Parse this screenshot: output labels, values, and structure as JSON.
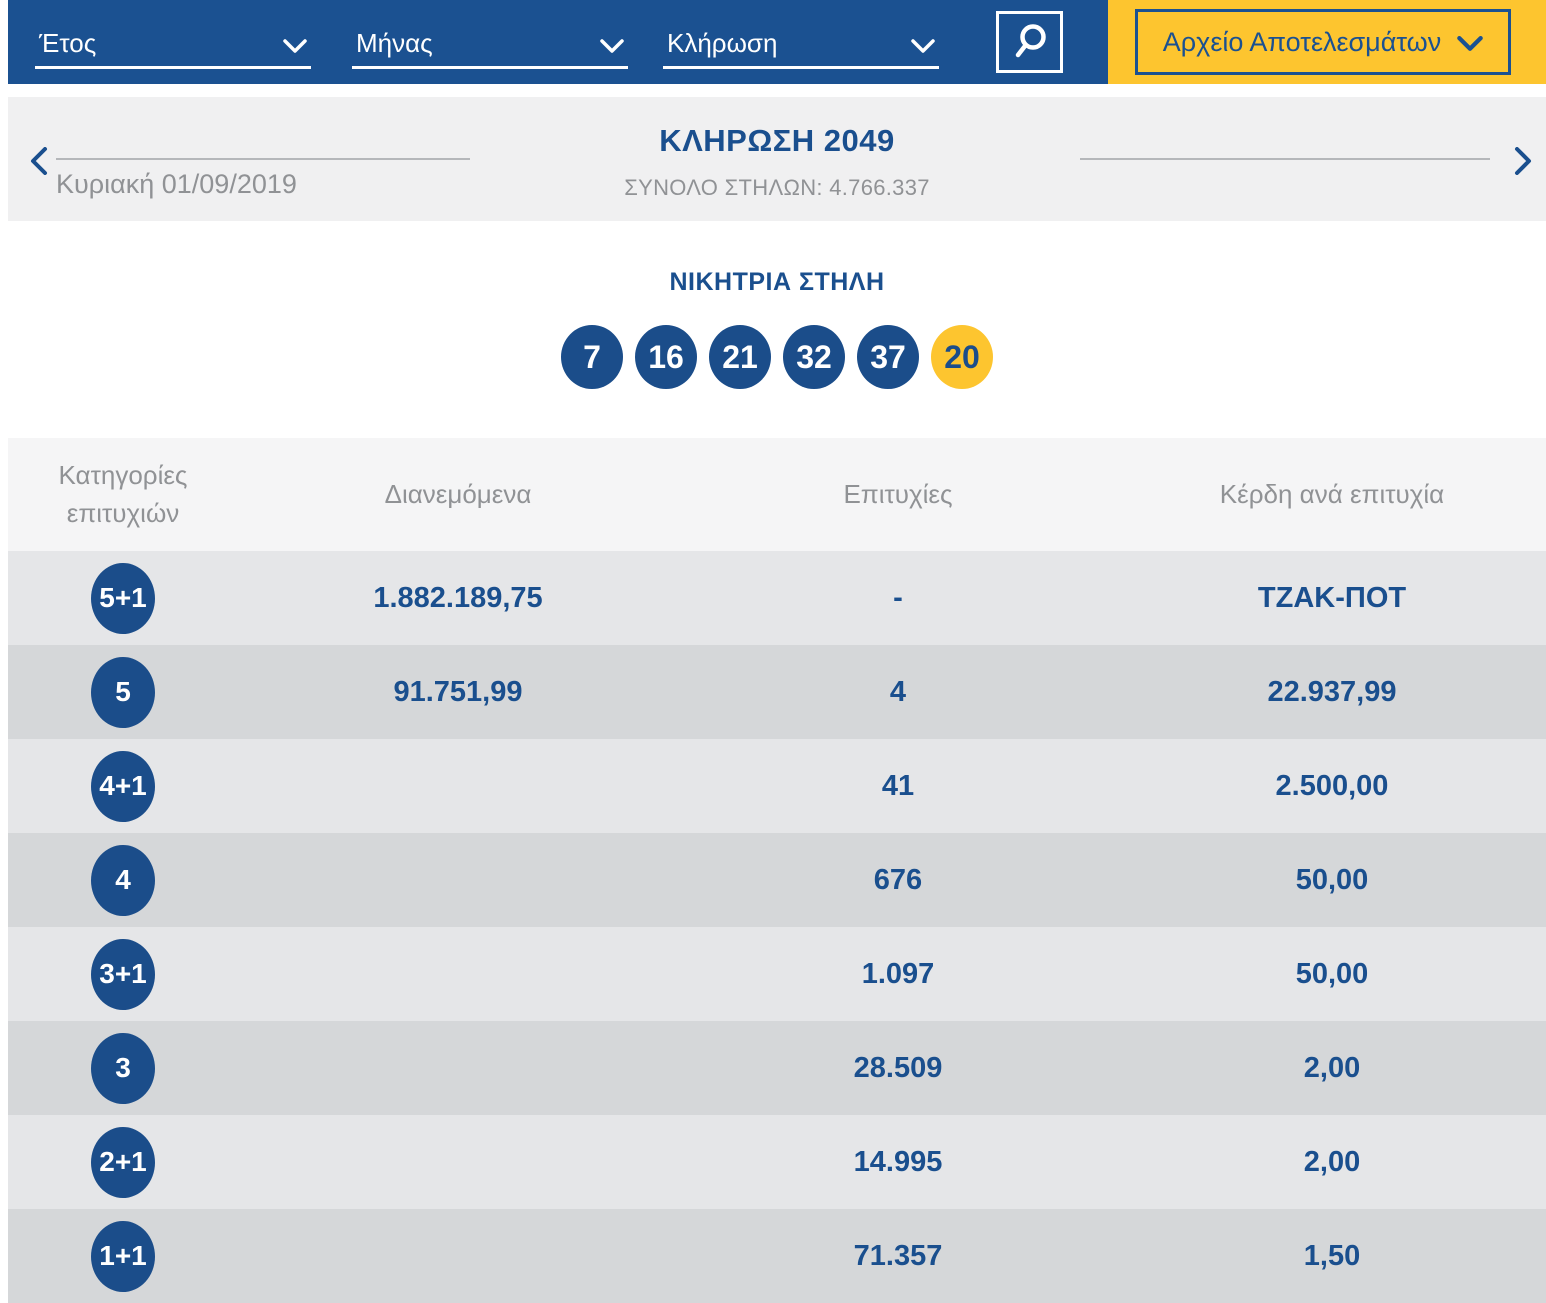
{
  "colors": {
    "bar_blue": "#1b5191",
    "accent_yellow": "#fdc52f",
    "ball_blue": "#1b4d8a",
    "text_blue": "#1a4f8e",
    "muted_gray": "#909295",
    "row_light": "#e5e6e8",
    "row_dark": "#d5d7d9"
  },
  "topbar": {
    "dropdowns": [
      {
        "label": "Έτος"
      },
      {
        "label": "Μήνας"
      },
      {
        "label": "Κλήρωση"
      }
    ],
    "search_icon": "magnifier-icon",
    "archive_button_label": "Αρχείο Αποτελεσμάτων"
  },
  "draw_nav": {
    "date": "Κυριακή 01/09/2019",
    "title": "ΚΛΗΡΩΣΗ 2049",
    "total_columns": "ΣΥΝΟΛΟ ΣΤΗΛΩΝ: 4.766.337"
  },
  "winning_column": {
    "title": "ΝΙΚΗΤΡΙΑ ΣΤΗΛΗ",
    "numbers": [
      {
        "value": "7",
        "type": "main"
      },
      {
        "value": "16",
        "type": "main"
      },
      {
        "value": "21",
        "type": "main"
      },
      {
        "value": "32",
        "type": "main"
      },
      {
        "value": "37",
        "type": "main"
      },
      {
        "value": "20",
        "type": "joker"
      }
    ]
  },
  "results_table": {
    "headers": [
      "Κατηγορίες επιτυχιών",
      "Διανεμόμενα",
      "Επιτυχίες",
      "Κέρδη ανά επιτυχία"
    ],
    "rows": [
      {
        "category": "5+1",
        "distributed": "1.882.189,75",
        "winners": "-",
        "payout": "ΤΖΑΚ-ΠΟΤ"
      },
      {
        "category": "5",
        "distributed": "91.751,99",
        "winners": "4",
        "payout": "22.937,99"
      },
      {
        "category": "4+1",
        "distributed": "",
        "winners": "41",
        "payout": "2.500,00"
      },
      {
        "category": "4",
        "distributed": "",
        "winners": "676",
        "payout": "50,00"
      },
      {
        "category": "3+1",
        "distributed": "",
        "winners": "1.097",
        "payout": "50,00"
      },
      {
        "category": "3",
        "distributed": "",
        "winners": "28.509",
        "payout": "2,00"
      },
      {
        "category": "2+1",
        "distributed": "",
        "winners": "14.995",
        "payout": "2,00"
      },
      {
        "category": "1+1",
        "distributed": "",
        "winners": "71.357",
        "payout": "1,50"
      }
    ]
  }
}
